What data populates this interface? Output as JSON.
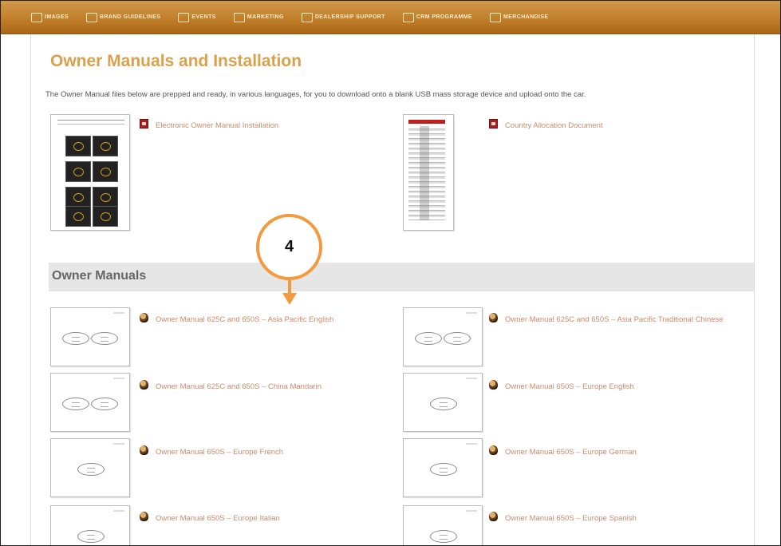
{
  "nav": {
    "items": [
      {
        "label": "IMAGES",
        "icon": "images-icon"
      },
      {
        "label": "BRAND GUIDELINES",
        "icon": "book-icon"
      },
      {
        "label": "EVENTS",
        "icon": "events-icon"
      },
      {
        "label": "MARKETING",
        "icon": "marketing-icon"
      },
      {
        "label": "DEALERSHIP SUPPORT",
        "icon": "checklist-icon"
      },
      {
        "label": "CRM PROGRAMME",
        "icon": "crm-icon"
      },
      {
        "label": "MERCHANDISE",
        "icon": "shirt-icon"
      }
    ]
  },
  "page": {
    "title": "Owner Manuals and Installation",
    "intro": "The Owner Manual files below are prepped and ready, in various languages, for you to download onto a blank USB mass storage device and upload onto the car."
  },
  "documents": [
    {
      "label": "Electronic Owner Manual Installation",
      "icon": "pdf-icon"
    },
    {
      "label": "Country Allocation Document",
      "icon": "pdf-icon"
    }
  ],
  "section": {
    "title": "Owner Manuals"
  },
  "manuals": [
    {
      "label": "Owner Manual 625C and 650S – Asia Pacific English",
      "icon": "driver-head-icon"
    },
    {
      "label": "Owner Manual 625C and 650S – Asia Pacific Traditional Chinese",
      "icon": "driver-head-icon"
    },
    {
      "label": "Owner Manual 625C and 650S – China Mandarin",
      "icon": "driver-head-icon"
    },
    {
      "label": "Owner Manual 650S – Europe English",
      "icon": "driver-head-icon"
    },
    {
      "label": "Owner Manual 650S – Europe French",
      "icon": "driver-head-icon"
    },
    {
      "label": "Owner Manual 650S – Europe German",
      "icon": "driver-head-icon"
    },
    {
      "label": "Owner Manual 650S – Europe Italian",
      "icon": "driver-head-icon"
    },
    {
      "label": "Owner Manual 650S – Europe Spanish",
      "icon": "driver-head-icon"
    }
  ],
  "callout": {
    "number": "4"
  },
  "colors": {
    "accent": "#dba14a",
    "nav": "#c27f2a",
    "link": "#c98b6d",
    "callout": "#f29a3d"
  }
}
